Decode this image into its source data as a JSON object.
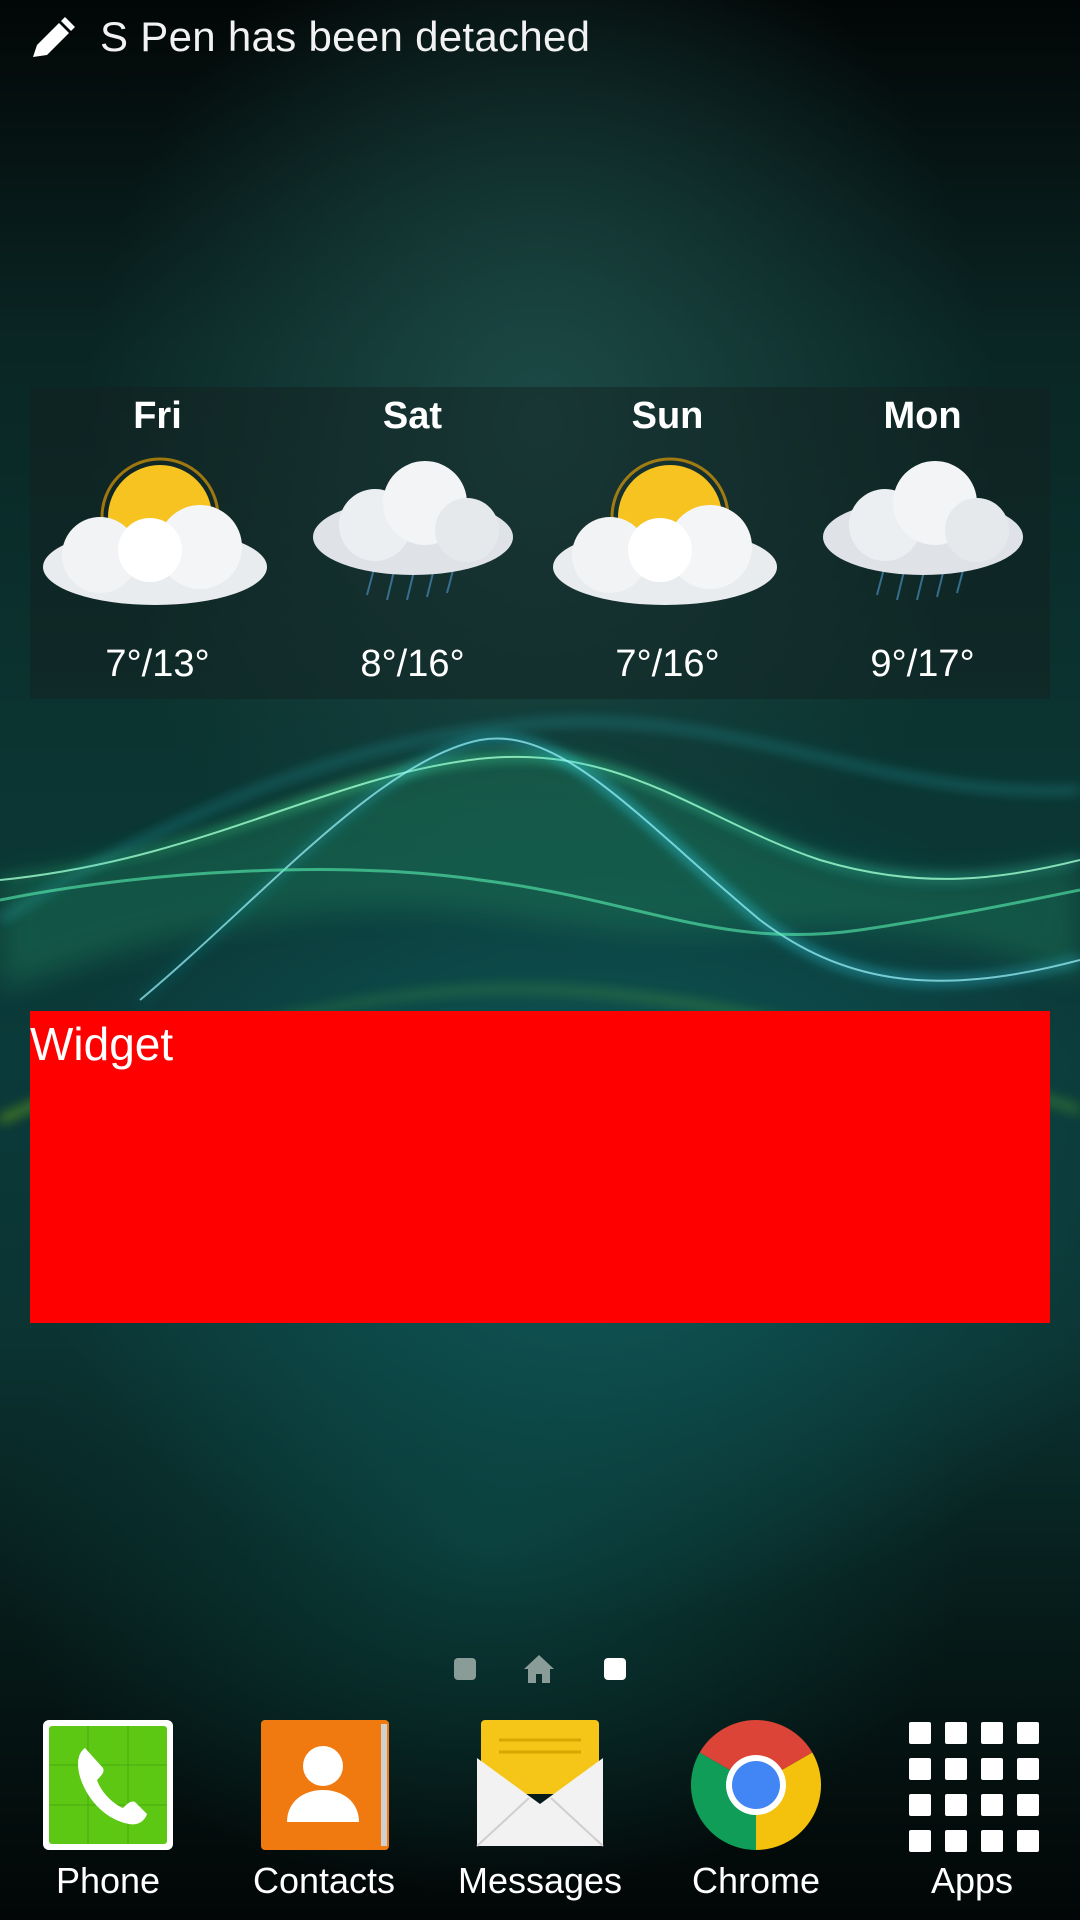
{
  "notification": {
    "icon": "pen-icon",
    "text": "S Pen has been detached"
  },
  "weather": {
    "days": [
      {
        "name": "Fri",
        "icon": "partly-cloudy-icon",
        "temp": "7°/13°"
      },
      {
        "name": "Sat",
        "icon": "rain-cloud-icon",
        "temp": "8°/16°"
      },
      {
        "name": "Sun",
        "icon": "partly-cloudy-icon",
        "temp": "7°/16°"
      },
      {
        "name": "Mon",
        "icon": "rain-cloud-icon",
        "temp": "9°/17°"
      }
    ]
  },
  "widget": {
    "label": "Widget",
    "color": "#ff0000"
  },
  "pager": {
    "pages": 3,
    "current": 3
  },
  "dock": {
    "items": [
      {
        "label": "Phone",
        "icon": "phone-icon",
        "color": "#5cc814"
      },
      {
        "label": "Contacts",
        "icon": "contacts-icon",
        "color": "#f07a10"
      },
      {
        "label": "Messages",
        "icon": "messages-icon",
        "color": "#f5c518"
      },
      {
        "label": "Chrome",
        "icon": "chrome-icon",
        "color": "#db4437"
      },
      {
        "label": "Apps",
        "icon": "apps-grid-icon",
        "color": "#ffffff"
      }
    ]
  }
}
